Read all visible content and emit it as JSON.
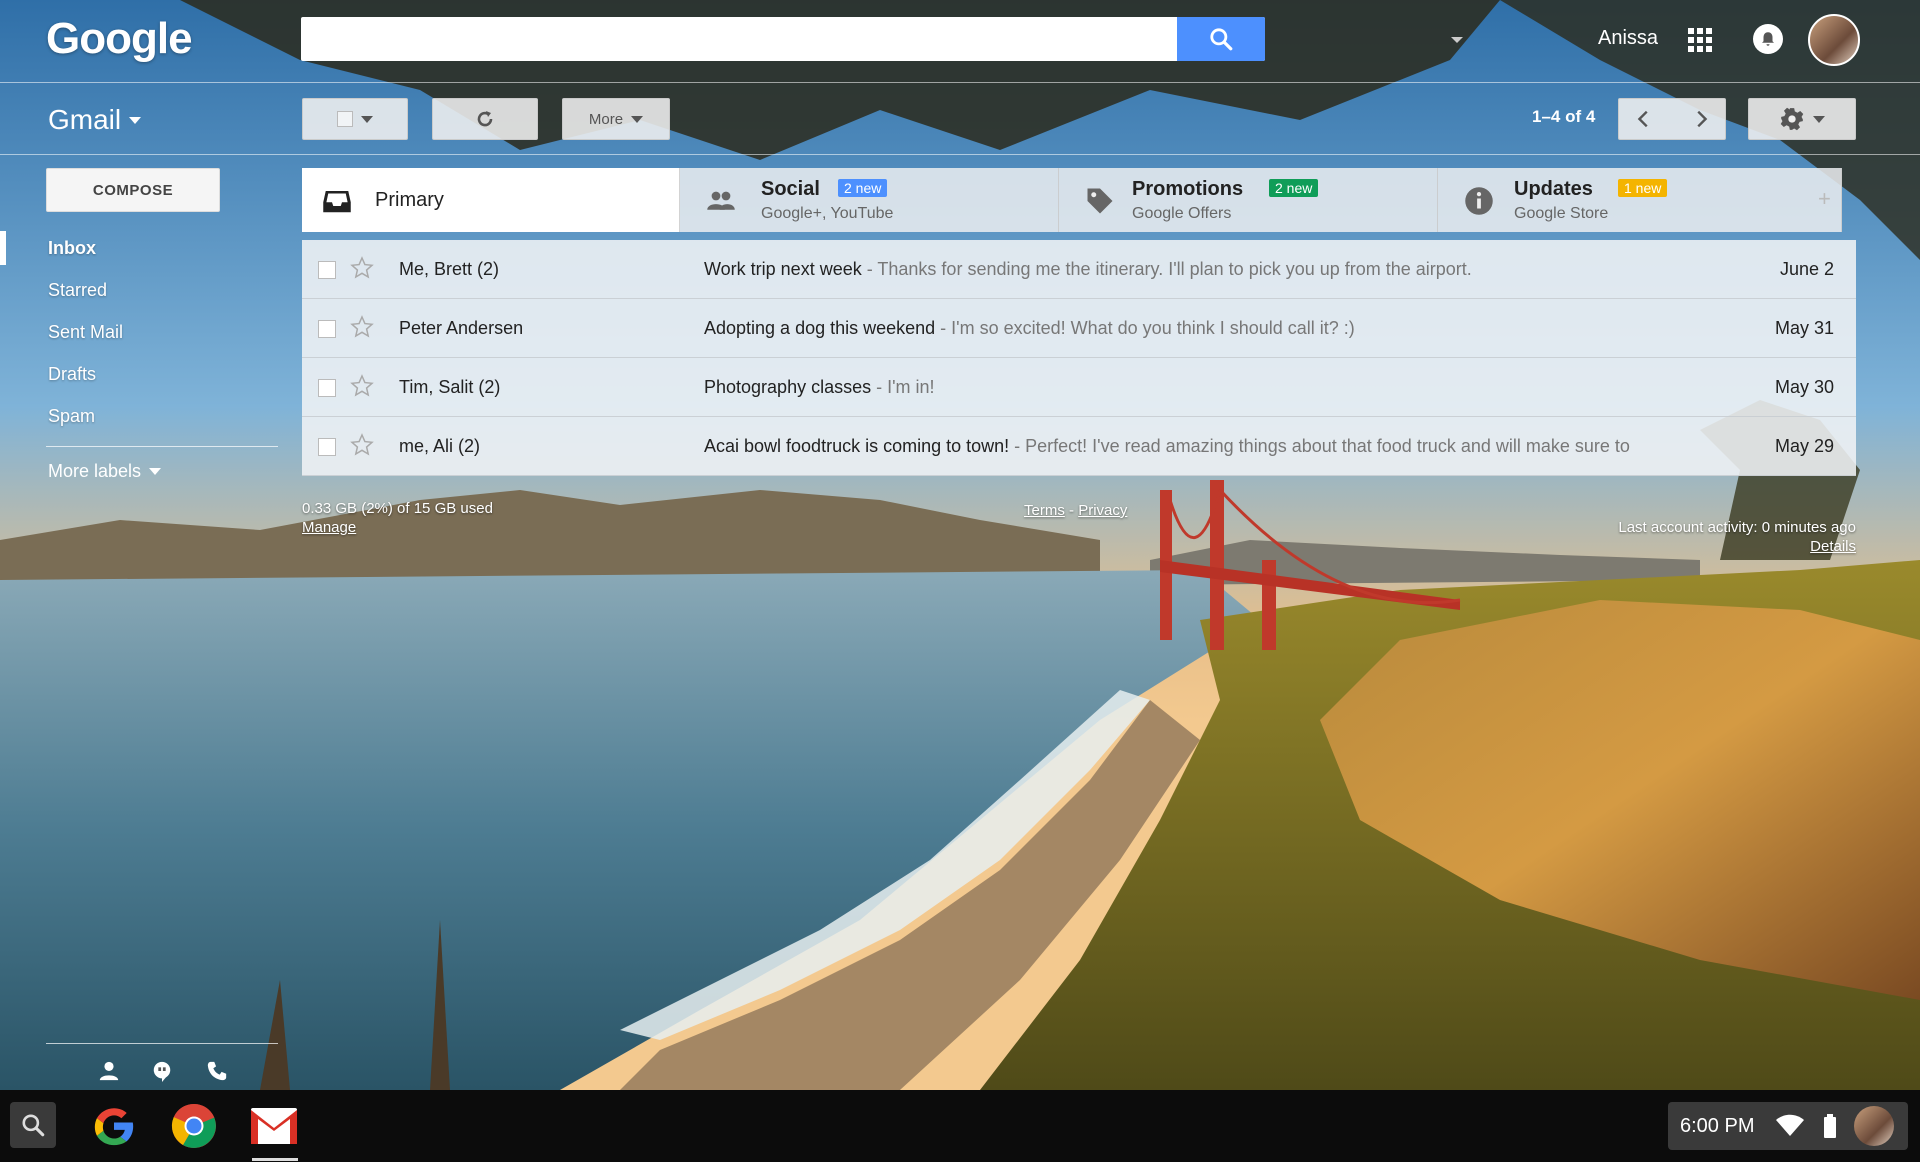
{
  "header": {
    "logo": "Google",
    "search": {
      "value": "",
      "placeholder": ""
    },
    "user_name": "Anissa"
  },
  "toolbar": {
    "gmail_label": "Gmail",
    "more_label": "More",
    "pager": "1–4 of 4"
  },
  "sidebar": {
    "compose_label": "COMPOSE",
    "items": [
      {
        "label": "Inbox",
        "active": true
      },
      {
        "label": "Starred"
      },
      {
        "label": "Sent Mail"
      },
      {
        "label": "Drafts"
      },
      {
        "label": "Spam"
      }
    ],
    "more_labels": "More labels"
  },
  "tabs": [
    {
      "title": "Primary",
      "sub": "",
      "badge": ""
    },
    {
      "title": "Social",
      "sub": "Google+, YouTube",
      "badge": "2 new",
      "badge_color": "#4d90fe"
    },
    {
      "title": "Promotions",
      "sub": "Google Offers",
      "badge": "2 new",
      "badge_color": "#0f9d58"
    },
    {
      "title": "Updates",
      "sub": "Google Store",
      "badge": "1 new",
      "badge_color": "#f4b400"
    }
  ],
  "messages": [
    {
      "sender": "Me, Brett (2)",
      "subject": "Work trip next week",
      "snippet": " - Thanks for sending me the itinerary. I'll plan to pick you up from the airport.",
      "date": "June 2"
    },
    {
      "sender": "Peter Andersen",
      "subject": "Adopting a dog this weekend",
      "snippet": " - I'm so excited! What do you think I should call it? :)",
      "date": "May 31"
    },
    {
      "sender": "Tim, Salit (2)",
      "subject": "Photography classes",
      "snippet": " - I'm in!",
      "date": "May 30"
    },
    {
      "sender": "me, Ali (2)",
      "subject": "Acai bowl foodtruck is coming to town!",
      "snippet": " - Perfect! I've read amazing things about that food truck and will make sure to",
      "date": "May 29"
    }
  ],
  "footer": {
    "storage": "0.33 GB (2%) of 15 GB used",
    "manage": "Manage",
    "terms": "Terms",
    "dash": " - ",
    "privacy": "Privacy",
    "last_activity": "Last account activity: 0 minutes ago",
    "details": "Details"
  },
  "shelf": {
    "time": "6:00 PM"
  },
  "colors": {
    "accent": "#4d90fe",
    "gmail_red": "#d93025"
  }
}
